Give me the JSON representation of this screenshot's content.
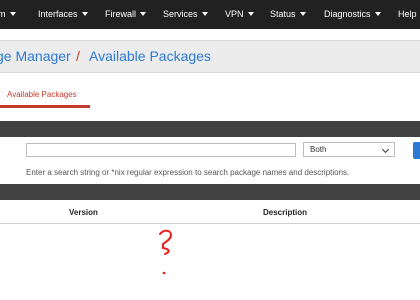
{
  "nav": {
    "items": [
      {
        "label": "m",
        "caret": true
      },
      {
        "label": "Interfaces",
        "caret": true
      },
      {
        "label": "Firewall",
        "caret": true
      },
      {
        "label": "Services",
        "caret": true
      },
      {
        "label": "VPN",
        "caret": true
      },
      {
        "label": "Status",
        "caret": true
      },
      {
        "label": "Diagnostics",
        "caret": true
      },
      {
        "label": "Help",
        "caret": false
      }
    ]
  },
  "breadcrumb": {
    "parent": "ge Manager",
    "separator": "/",
    "current": "Available Packages"
  },
  "tabs": [
    {
      "label": "Available Packages",
      "active": true
    }
  ],
  "search": {
    "value": "",
    "placeholder": "",
    "filter_selected": "Both",
    "help_text": "Enter a search string or *nix regular expression to search package names and descriptions."
  },
  "table": {
    "columns": [
      "Version",
      "Description"
    ]
  },
  "annotation": {
    "mark": "?",
    "color": "#e8201a"
  },
  "colors": {
    "navbar": "#212121",
    "link": "#2c7ad4",
    "accent_red": "#c43b2b",
    "panel_heading": "#424242"
  }
}
